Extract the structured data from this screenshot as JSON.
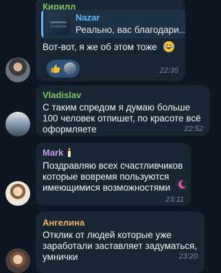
{
  "colors": {
    "background": "#0e1621",
    "bubble": "#182533",
    "sender_kirill": "#7fc964",
    "sender_vladislav": "#7fc964",
    "sender_mark": "#c99bf0",
    "sender_angelina": "#f0b45a",
    "reply_accent": "#5eb5f7",
    "timestamp": "#7b8b9b"
  },
  "messages": [
    {
      "sender": "Кирилл",
      "reply": {
        "name": "Nazar",
        "text": "Реально, вас благодари..."
      },
      "text": "Вот-вот, я же об этом тоже",
      "emoji": "laughing-tears-emoji",
      "reactions": [
        "thumbs-up-emoji",
        "reactor-avatar"
      ],
      "time": "22:35"
    },
    {
      "sender": "Vladislav",
      "lines": [
        "С таким спредом я думаю больше",
        "100 человек отпишет, по красоте всё",
        "оформляете"
      ],
      "time": "22:52"
    },
    {
      "sender": "Mark",
      "badge": "candle-icon",
      "lines": [
        "Поздравляю всех счастливчиков",
        "которые вовремя пользуются",
        "имеющимися возможностями"
      ],
      "time": "23:11"
    },
    {
      "sender": "Ангелина",
      "lines": [
        "Отклик от людей которые уже",
        "заработали заставляет задуматься,",
        "умнички"
      ],
      "time": "23:20"
    }
  ]
}
